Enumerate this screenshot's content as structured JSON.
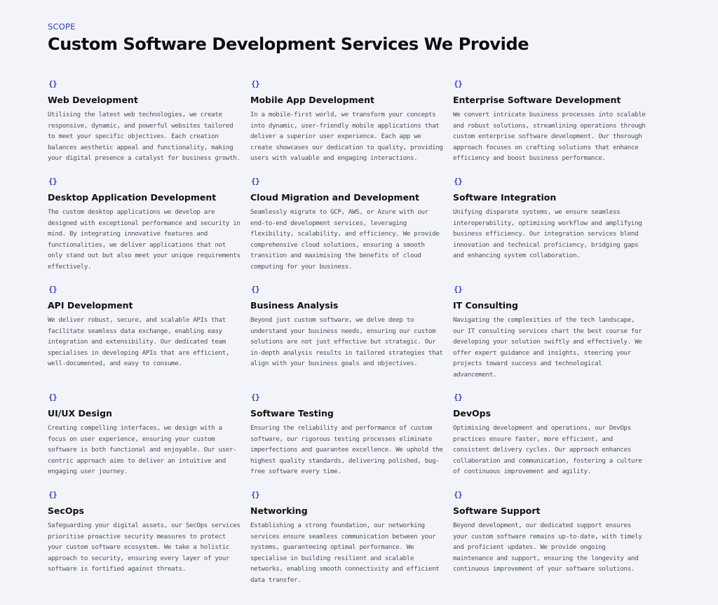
{
  "section": {
    "eyebrow": "SCOPE",
    "title": "Custom Software Development Services We Provide"
  },
  "icon": {
    "name": "code-braces-icon",
    "glyph": "{}",
    "color": "#2e41c9"
  },
  "services": [
    {
      "title": "Web Development",
      "description": "Utilising the latest web technologies, we create responsive, dynamic, and powerful websites tailored to meet your specific objectives. Each creation balances aesthetic appeal and functionality, making your digital presence a catalyst for business growth."
    },
    {
      "title": "Mobile App Development",
      "description": "In a mobile-first world, we transform your concepts into dynamic, user-friendly mobile applications that deliver a superior user experience. Each app we create showcases our dedication to quality, providing users with valuable and engaging interactions."
    },
    {
      "title": "Enterprise Software Development",
      "description": "We convert intricate business processes into scalable and robust solutions, streamlining operations through custom enterprise software development. Our thorough approach focuses on crafting solutions that enhance efficiency and boost business performance."
    },
    {
      "title": "Desktop Application Development",
      "description": "The custom desktop applications we develop are designed with exceptional performance and security in mind. By integrating innovative features and functionalities, we deliver applications that not only stand out but also meet your unique requirements effectively."
    },
    {
      "title": "Cloud Migration and Development",
      "description": "Seamlessly migrate to GCP, AWS, or Azure with our end-to-end development services, leveraging flexibility, scalability, and efficiency. We provide comprehensive cloud solutions, ensuring a smooth transition and maximising the benefits of cloud computing for your business."
    },
    {
      "title": "Software Integration",
      "description": "Unifying disparate systems, we ensure seamless interoperability, optimising workflow and amplifying business efficiency. Our integration services blend innovation and technical proficiency, bridging gaps and enhancing system collaboration."
    },
    {
      "title": "API Development",
      "description": "We deliver robust, secure, and scalable APIs that facilitate seamless data exchange, enabling easy integration and extensibility. Our dedicated team specialises in developing APIs that are efficient, well-documented, and easy to consume."
    },
    {
      "title": "Business Analysis",
      "description": "Beyond just custom software, we delve deep to understand your business needs, ensuring our custom solutions are not just effective but strategic. Our in-depth analysis results in tailored strategies that align with your business goals and objectives."
    },
    {
      "title": "IT Consulting",
      "description": "Navigating the complexities of the tech landscape, our IT consulting services chart the best course for developing your solution swiftly and effectively. We offer expert guidance and insights, steering your projects toward success and technological advancement."
    },
    {
      "title": "UI/UX Design",
      "description": "Creating compelling interfaces, we design with a focus on user experience, ensuring your custom software is both functional and enjoyable. Our user-centric approach aims to deliver an intuitive and engaging user journey."
    },
    {
      "title": "Software Testing",
      "description": "Ensuring the reliability and performance of custom software, our rigorous testing processes eliminate imperfections and guarantee excellence. We uphold the highest quality standards, delivering polished, bug-free software every time."
    },
    {
      "title": "DevOps",
      "description": "Optimising development and operations, our DevOps practices ensure faster, more efficient, and consistent delivery cycles. Our approach enhances collaboration and communication, fostering a culture of continuous improvement and agility."
    },
    {
      "title": "SecOps",
      "description": "Safeguarding your digital assets, our SecOps services prioritise proactive security measures to protect your custom software ecosystem. We take a holistic approach to security, ensuring every layer of your software is fortified against threats."
    },
    {
      "title": "Networking",
      "description": "Establishing a strong foundation, our networking services ensure seamless communication between your systems, guaranteeing optimal performance. We specialise in building resilient and scalable networks, enabling smooth connectivity and efficient data transfer."
    },
    {
      "title": "Software Support",
      "description": "Beyond development, our dedicated support ensures your custom software remains up-to-date, with timely and proficient updates. We provide ongoing maintenance and support, ensuring the longevity and continuous improvement of your software solutions."
    }
  ]
}
